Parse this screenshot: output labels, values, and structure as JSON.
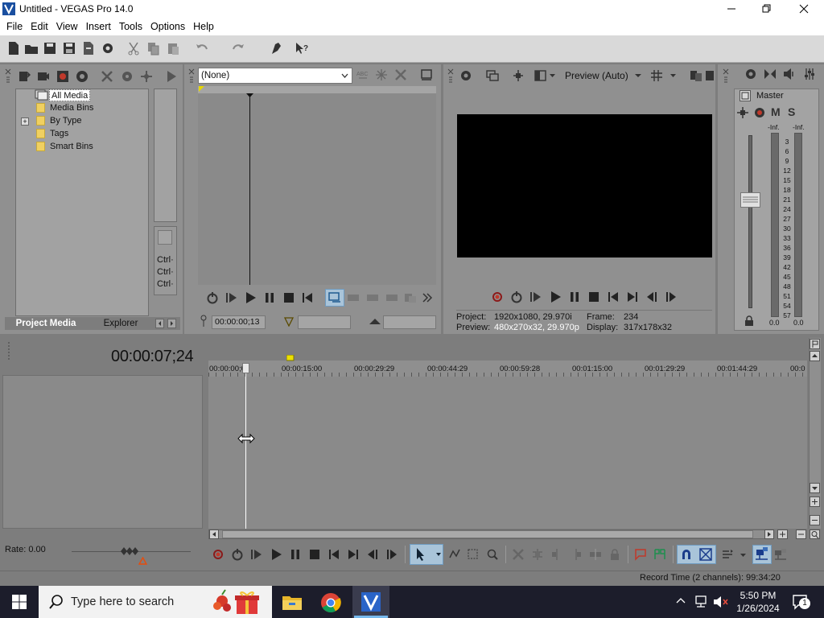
{
  "window": {
    "title": "Untitled - VEGAS Pro 14.0",
    "minimize": "minimize-icon",
    "maximize": "restore-icon",
    "close": "close-icon"
  },
  "menu": [
    "File",
    "Edit",
    "View",
    "Insert",
    "Tools",
    "Options",
    "Help"
  ],
  "project_media": {
    "tree": [
      "All Media",
      "Media Bins",
      "By Type",
      "Tags",
      "Smart Bins"
    ],
    "expand_symbol": "+",
    "side_keys": [
      "Ctrl·",
      "Ctrl·",
      "Ctrl·"
    ],
    "tabs": [
      "Project Media",
      "Explorer"
    ]
  },
  "trimmer": {
    "dropdown": "(None)",
    "timecode": "00:00:00;13"
  },
  "preview": {
    "quality": "Preview (Auto)",
    "project_label": "Project:",
    "project_value": "1920x1080, 29.970i",
    "frame_label": "Frame:",
    "frame_value": "234",
    "preview_label": "Preview:",
    "preview_value": "480x270x32, 29.970p",
    "display_label": "Display:",
    "display_value": "317x178x32",
    "background": "#000000"
  },
  "master": {
    "title": "Master",
    "mute": "M",
    "solo": "S",
    "inf_left": "-Inf.",
    "inf_right": "-Inf.",
    "scale": [
      "3",
      "6",
      "9",
      "12",
      "15",
      "18",
      "21",
      "24",
      "27",
      "30",
      "33",
      "36",
      "39",
      "42",
      "45",
      "48",
      "51",
      "54",
      "57"
    ],
    "level_left": "0.0",
    "level_right": "0.0"
  },
  "timeline": {
    "timecode": "00:00:07;24",
    "ruler": [
      "00:00:00;00",
      "00:00:15:00",
      "00:00:29:29",
      "00:00:44:29",
      "00:00:59:28",
      "00:01:15:00",
      "00:01:29:29",
      "00:01:44:29",
      "00:0"
    ],
    "rate": "Rate: 0.00",
    "record_time": "Record Time (2 channels): 99:34:20"
  },
  "taskbar": {
    "search_placeholder": "Type here to search",
    "time": "5:50 PM",
    "date": "1/26/2024",
    "notification_count": "1",
    "bg": "#1c1d2b"
  }
}
